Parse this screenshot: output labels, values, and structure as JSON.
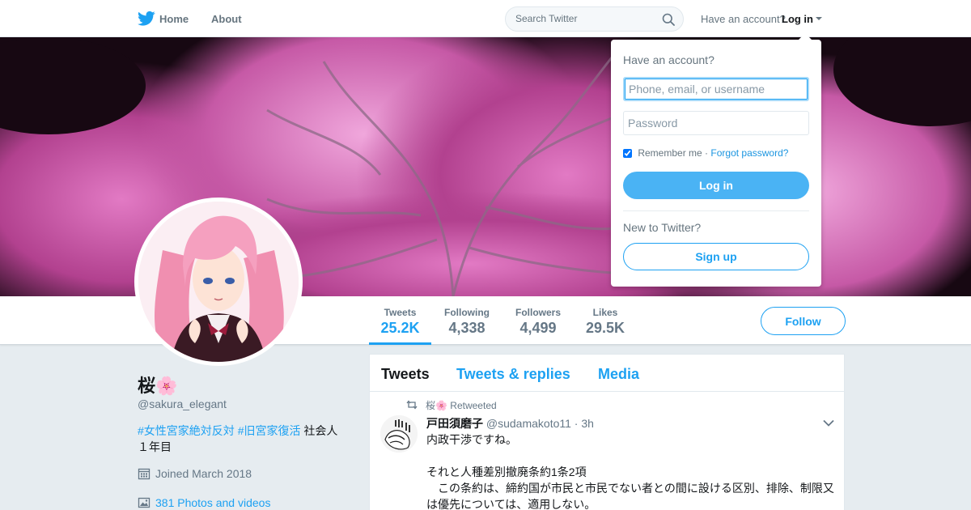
{
  "nav": {
    "home_label": "Home",
    "about_label": "About",
    "search_placeholder": "Search Twitter",
    "have_account": "Have an account?",
    "login_label": "Log in",
    "icons": {
      "logo": "twitter-bird-icon",
      "search": "search-icon",
      "caret": "caret-down-icon"
    }
  },
  "login_dropdown": {
    "title": "Have an account?",
    "username_placeholder": "Phone, email, or username",
    "password_placeholder": "Password",
    "remember_me": "Remember me",
    "separator": "·",
    "forgot_password": "Forgot password?",
    "remember_checked": true,
    "login_button": "Log in",
    "new_to_twitter": "New to Twitter?",
    "signup_button": "Sign up"
  },
  "profile_nav": {
    "stats": [
      {
        "label": "Tweets",
        "value": "25.2K",
        "active": true
      },
      {
        "label": "Following",
        "value": "4,338"
      },
      {
        "label": "Followers",
        "value": "4,499"
      },
      {
        "label": "Likes",
        "value": "29.5K"
      }
    ],
    "follow_button": "Follow"
  },
  "profile": {
    "name": "桜🌸",
    "handle": "@sakura_elegant",
    "bio_hashtag_1": "#女性宮家絶対反対",
    "bio_hashtag_2": "#旧宮家復活",
    "bio_text_1": "社会人",
    "bio_text_2": "１年目",
    "joined": "Joined March 2018",
    "photos": "381 Photos and videos",
    "icons": {
      "joined": "calendar-icon",
      "photos": "image-icon"
    }
  },
  "timeline": {
    "tabs": [
      {
        "label": "Tweets",
        "active": true
      },
      {
        "label": "Tweets & replies"
      },
      {
        "label": "Media"
      }
    ],
    "tweets": [
      {
        "retweeted_by": "桜🌸",
        "retweeted_label": "Retweeted",
        "author_name": "戸田須磨子",
        "author_handle": "@sudamakoto11",
        "time": "· 3h",
        "text": "内政干渉ですね。\n\nそれと人種差別撤廃条約1条2項\n　この条約は、締約国が市民と市民でない者との間に設ける区別、排除、制限又は優先については、適用しない。"
      }
    ]
  },
  "colors": {
    "accent": "#1da1f2",
    "login_button": "#4ab3f4",
    "background": "#e6ecf0",
    "banner_blossom": "#c24a9a"
  }
}
